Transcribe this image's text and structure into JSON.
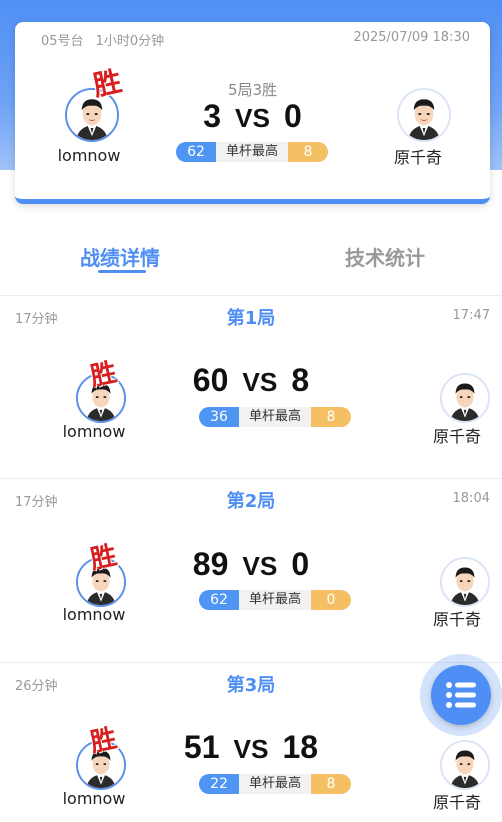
{
  "match": {
    "table": "05号台",
    "duration": "1小时0分钟",
    "datetime": "2025/07/09 18:30",
    "format": "5局3胜",
    "score_left": "3",
    "vs": "VS",
    "score_right": "0",
    "win_label": "胜",
    "player_left": "lomnow",
    "player_right": "原千奇",
    "break_left": "62",
    "break_label": "单杆最高",
    "break_right": "8"
  },
  "tabs": [
    {
      "label": "战绩详情",
      "active": true
    },
    {
      "label": "技术统计",
      "active": false
    }
  ],
  "frames": [
    {
      "duration": "17分钟",
      "title": "第1局",
      "time": "17:47",
      "score_left": "60",
      "vs": "VS",
      "score_right": "8",
      "break_left": "36",
      "break_label": "单杆最高",
      "break_right": "8",
      "win_label": "胜",
      "player_left": "lomnow",
      "player_right": "原千奇"
    },
    {
      "duration": "17分钟",
      "title": "第2局",
      "time": "18:04",
      "score_left": "89",
      "vs": "VS",
      "score_right": "0",
      "break_left": "62",
      "break_label": "单杆最高",
      "break_right": "0",
      "win_label": "胜",
      "player_left": "lomnow",
      "player_right": "原千奇"
    },
    {
      "duration": "26分钟",
      "title": "第3局",
      "time": "",
      "score_left": "51",
      "vs": "VS",
      "score_right": "18",
      "break_left": "22",
      "break_label": "单杆最高",
      "break_right": "8",
      "win_label": "胜",
      "player_left": "lomnow",
      "player_right": "原千奇"
    }
  ],
  "fab": {
    "icon": "list-icon"
  },
  "colors": {
    "accent": "#4f8ff5",
    "win": "#d81e1e",
    "break_left": "#4f95f3",
    "break_right": "#f5c064"
  }
}
